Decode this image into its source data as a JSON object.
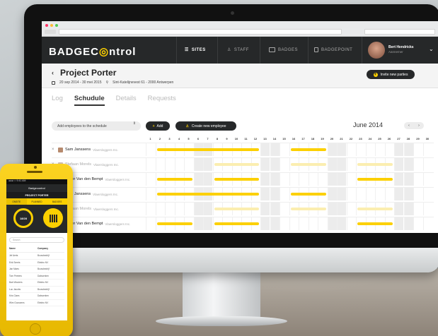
{
  "app": {
    "logo_part1": "BADGEC",
    "logo_part2": "ntrol",
    "nav": [
      {
        "label": "SITES",
        "active": true
      },
      {
        "label": "STAFF",
        "active": false
      },
      {
        "label": "BADGES",
        "active": false
      },
      {
        "label": "BADGEPOINT",
        "active": false
      }
    ],
    "user": {
      "name": "Bert Hendricks",
      "role": "Aannemer"
    }
  },
  "project": {
    "title": "Project Porter",
    "dates": "20 sep 2014 - 30 mei 2015",
    "address": "Sint-Katelijnevest 61 - 2000 Antwerpen",
    "invite_label": "Invite new parties",
    "back_glyph": "‹"
  },
  "tabs": [
    {
      "label": "Log",
      "active": false
    },
    {
      "label": "Schudule",
      "active": true
    },
    {
      "label": "Details",
      "active": false
    },
    {
      "label": "Requests",
      "active": false
    }
  ],
  "toolbar": {
    "select_label": "Add employees to the schedule",
    "add_label": "Add",
    "create_label": "Create new employee",
    "month": "June 2014",
    "prev": "‹",
    "next": "›"
  },
  "schedule": {
    "days": [
      "1",
      "2",
      "3",
      "4",
      "5",
      "6",
      "7",
      "8",
      "9",
      "10",
      "11",
      "12",
      "13",
      "14",
      "15",
      "16",
      "17",
      "18",
      "19",
      "20",
      "21",
      "22",
      "23",
      "24",
      "25",
      "26",
      "27",
      "28",
      "29",
      "30"
    ],
    "weekend_days": [
      6,
      7,
      13,
      14,
      20,
      21,
      27,
      28
    ],
    "rows": [
      {
        "name": "Sam Janssens",
        "company": "Vlaersloggers Inc.",
        "dim": false,
        "bars": [
          {
            "from": 2,
            "to": 12,
            "pale": false
          },
          {
            "from": 16,
            "to": 19,
            "pale": false
          }
        ]
      },
      {
        "name": "Stefaan Morels",
        "company": "Vlaersloggers Inc.",
        "dim": true,
        "bars": [
          {
            "from": 8,
            "to": 12,
            "pale": true
          },
          {
            "from": 16,
            "to": 19,
            "pale": true
          },
          {
            "from": 23,
            "to": 26,
            "pale": true
          }
        ]
      },
      {
        "name": "Didier Van den Bempt",
        "company": "Vlaersloggers Inc.",
        "dim": false,
        "bars": [
          {
            "from": 2,
            "to": 5,
            "pale": false
          },
          {
            "from": 8,
            "to": 12,
            "pale": false
          },
          {
            "from": 23,
            "to": 26,
            "pale": false
          }
        ]
      },
      {
        "name": "Sam Janssens",
        "company": "Vlaersloggers Inc.",
        "dim": false,
        "bars": [
          {
            "from": 2,
            "to": 12,
            "pale": false
          },
          {
            "from": 16,
            "to": 19,
            "pale": false
          }
        ]
      },
      {
        "name": "Stefaan Morels",
        "company": "Vlaersloggers Inc.",
        "dim": true,
        "bars": [
          {
            "from": 8,
            "to": 12,
            "pale": true
          },
          {
            "from": 16,
            "to": 19,
            "pale": true
          },
          {
            "from": 23,
            "to": 26,
            "pale": true
          }
        ]
      },
      {
        "name": "Didier Van den Bempt",
        "company": "Vlaersloggers Inc.",
        "dim": false,
        "bars": [
          {
            "from": 2,
            "to": 5,
            "pale": false
          },
          {
            "from": 8,
            "to": 12,
            "pale": false
          },
          {
            "from": 23,
            "to": 26,
            "pale": false
          }
        ]
      }
    ]
  },
  "phone": {
    "status": "●●●○○ 9:41 AM",
    "header": "Badgecontrol",
    "sub": "PROJECT PORTER",
    "tabs": [
      "ONSITE",
      "PLANNED",
      "BADGES"
    ],
    "ring_value": "18/28",
    "search_placeholder": "Search",
    "list_headers": [
      "Name",
      "Company"
    ],
    "list_rows": [
      [
        "Jef Aerts",
        "Bouwbedrijf"
      ],
      [
        "Erik Smets",
        "Elektro NV"
      ],
      [
        "Jan Maes",
        "Bouwbedrijf"
      ],
      [
        "Tom Peeters",
        "Dakwerken"
      ],
      [
        "Bart Wouters",
        "Elektro NV"
      ],
      [
        "Luc Jacobs",
        "Bouwbedrijf"
      ],
      [
        "Kris Claes",
        "Dakwerken"
      ],
      [
        "Wim Goossens",
        "Elektro NV"
      ]
    ]
  },
  "colors": {
    "accent": "#fcd000",
    "dark": "#262829"
  }
}
